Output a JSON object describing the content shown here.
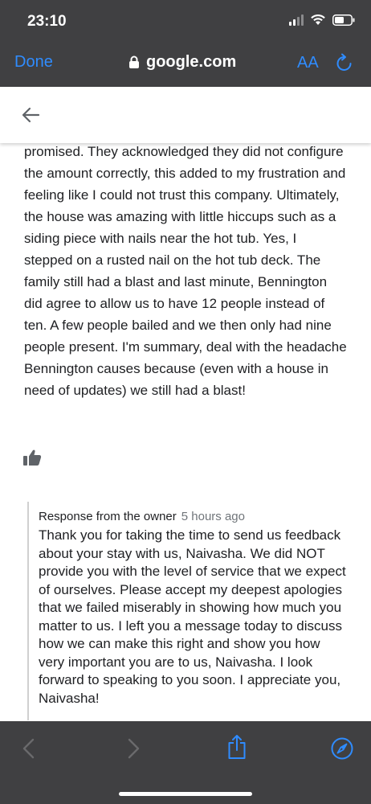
{
  "status_bar": {
    "time": "23:10"
  },
  "browser": {
    "done_label": "Done",
    "url": "google.com",
    "text_size_label": "AA"
  },
  "review": {
    "text": "promised. They acknowledged they did not configure the amount correctly, this added to my frustration and feeling like I could not trust this company. Ultimately, the house was amazing with little hiccups such as a siding piece with nails near the hot tub. Yes, I stepped on a rusted nail on the hot tub deck. The family still had a blast and last minute, Bennington did agree to allow us to have 12 people instead of ten. A few people bailed and we then only had nine people present. I'm summary, deal with the headache Bennington causes because (even with a house in need of updates) we still had a blast!"
  },
  "owner_response": {
    "label": "Response from the owner",
    "time": "5 hours ago",
    "text": "Thank you for taking the time to send us feedback about your stay with us, Naivasha. We did NOT provide you with the level of service that we expect of ourselves.  Please accept my deepest apologies that we failed miserably in showing how much you matter to us.  I left you a message today to discuss how we can make this right and show you how very important you are to us, Naivasha.  I look forward to speaking to you soon.  I appreciate you, Naivasha!"
  },
  "colors": {
    "chrome_bg": "#404042",
    "accent": "#2f8cff",
    "text": "#202124",
    "muted": "#70757a"
  }
}
